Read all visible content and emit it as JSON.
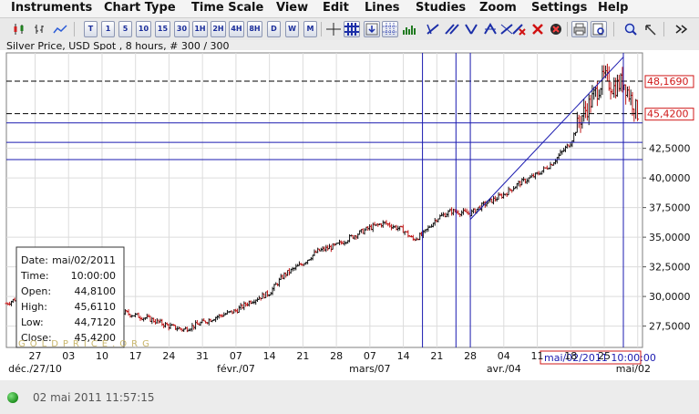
{
  "menu": {
    "items": [
      "Instruments",
      "Chart Type",
      "Time Scale",
      "View",
      "Edit",
      "Lines",
      "Studies",
      "Zoom",
      "Settings",
      "Help"
    ]
  },
  "toolbar": {
    "chart_type_icons": [
      "candlestick-chart-icon",
      "bar-chart-icon",
      "line-chart-icon"
    ],
    "period_buttons": [
      "T",
      "1",
      "5",
      "10",
      "15",
      "30",
      "1H",
      "2H",
      "4H",
      "8H",
      "D",
      "W",
      "M"
    ],
    "line_tool_icons": [
      "crosshair-icon",
      "grid-icon",
      "arrow-down-icon",
      "grid-dotted-icon",
      "volume-icon",
      "trendline-icon",
      "channel-icon",
      "fan-icon",
      "arc-icon",
      "retracement-icon",
      "retracement-alt-icon",
      "delete-line-icon",
      "delete-all-icon",
      "color-icon",
      "print-icon",
      "print-preview-icon",
      "zoom-in-icon",
      "zoom-out-icon",
      "more-icon"
    ]
  },
  "chart": {
    "title": "Silver Price, USD Spot , 8 hours, # 300 / 300",
    "watermark": "GOLDPRICE.ORG",
    "date_label": "mai/02/2011 10:00:00",
    "hlines": [
      {
        "value": 48.169,
        "label": "48,1690",
        "style": "dashed"
      },
      {
        "value": 45.42,
        "label": "45,4200",
        "style": "dashed"
      },
      {
        "value": 44.65,
        "label": "",
        "style": "solid"
      },
      {
        "value": 43.0,
        "label": "",
        "style": "solid"
      },
      {
        "value": 41.55,
        "label": "",
        "style": "solid"
      }
    ],
    "vlines": [
      "2011-03-18",
      "2011-03-25",
      "2011-03-28",
      "2011-04-29"
    ],
    "trendline": {
      "from": [
        "2011-03-28",
        36.5
      ],
      "to": [
        "2011-04-29",
        50.2
      ]
    }
  },
  "info_box": {
    "rows": [
      {
        "label": "Date:",
        "value": "mai/02/2011"
      },
      {
        "label": "Time:",
        "value": "10:00:00"
      },
      {
        "label": "Open:",
        "value": "44,8100"
      },
      {
        "label": "High:",
        "value": "45,6110"
      },
      {
        "label": "Low:",
        "value": "44,7120"
      },
      {
        "label": "Close:",
        "value": "45,4200"
      }
    ]
  },
  "chart_data": {
    "type": "bar",
    "title": "Silver Price, USD Spot , 8 hours, # 300 / 300",
    "y_ticks": [
      "27,5000",
      "30,0000",
      "32,5000",
      "35,0000",
      "37,5000",
      "40,0000",
      "42,5000"
    ],
    "y_tick_values": [
      27.5,
      30,
      32.5,
      35,
      37.5,
      40,
      42.5
    ],
    "ylim": [
      25.7,
      50.55
    ],
    "x_ticks": [
      "27",
      "03",
      "10",
      "17",
      "24",
      "31",
      "07",
      "14",
      "21",
      "28",
      "07",
      "14",
      "21",
      "28",
      "04",
      "11",
      "18",
      "25",
      "mai/02"
    ],
    "x_tick_dates": [
      "2010-12-27",
      "2011-01-03",
      "2011-01-10",
      "2011-01-17",
      "2011-01-24",
      "2011-01-31",
      "2011-02-07",
      "2011-02-14",
      "2011-02-21",
      "2011-02-28",
      "2011-03-07",
      "2011-03-14",
      "2011-03-21",
      "2011-03-28",
      "2011-04-04",
      "2011-04-11",
      "2011-04-18",
      "2011-04-25",
      "2011-05-02"
    ],
    "month_labels": [
      "déc./27/10",
      "févr./07",
      "mars/07",
      "avr./04",
      "mai/02"
    ],
    "month_label_dates": [
      "2010-12-27",
      "2011-02-07",
      "2011-03-07",
      "2011-04-04",
      "2011-05-02"
    ],
    "xlim": [
      "2010-12-21",
      "2011-05-03"
    ],
    "series": [
      {
        "dates": [
          "2010-12-21",
          "2010-12-24",
          "2010-12-27",
          "2010-12-30",
          "2011-01-03",
          "2011-01-05",
          "2011-01-07",
          "2011-01-10",
          "2011-01-13",
          "2011-01-17",
          "2011-01-20",
          "2011-01-24",
          "2011-01-27",
          "2011-01-31",
          "2011-02-03",
          "2011-02-07",
          "2011-02-10",
          "2011-02-14",
          "2011-02-17",
          "2011-02-21",
          "2011-02-24",
          "2011-02-28",
          "2011-03-03",
          "2011-03-07",
          "2011-03-10",
          "2011-03-14",
          "2011-03-16",
          "2011-03-18",
          "2011-03-21",
          "2011-03-24",
          "2011-03-28",
          "2011-03-31",
          "2011-04-04",
          "2011-04-07",
          "2011-04-11",
          "2011-04-14",
          "2011-04-18",
          "2011-04-20",
          "2011-04-22",
          "2011-04-25",
          "2011-04-27",
          "2011-04-29",
          "2011-05-02"
        ],
        "close": [
          29.4,
          30.0,
          30.3,
          30.9,
          30.7,
          29.2,
          29.6,
          29.6,
          28.8,
          28.4,
          28.1,
          27.5,
          27.2,
          27.8,
          28.3,
          28.8,
          29.6,
          30.3,
          31.8,
          32.8,
          33.8,
          34.3,
          35.0,
          35.8,
          36.2,
          35.6,
          34.8,
          35.2,
          36.6,
          37.2,
          37.0,
          37.8,
          38.6,
          39.5,
          40.3,
          41.2,
          43.0,
          45.0,
          46.3,
          48.5,
          47.6,
          48.17,
          45.42
        ]
      }
    ]
  }
}
